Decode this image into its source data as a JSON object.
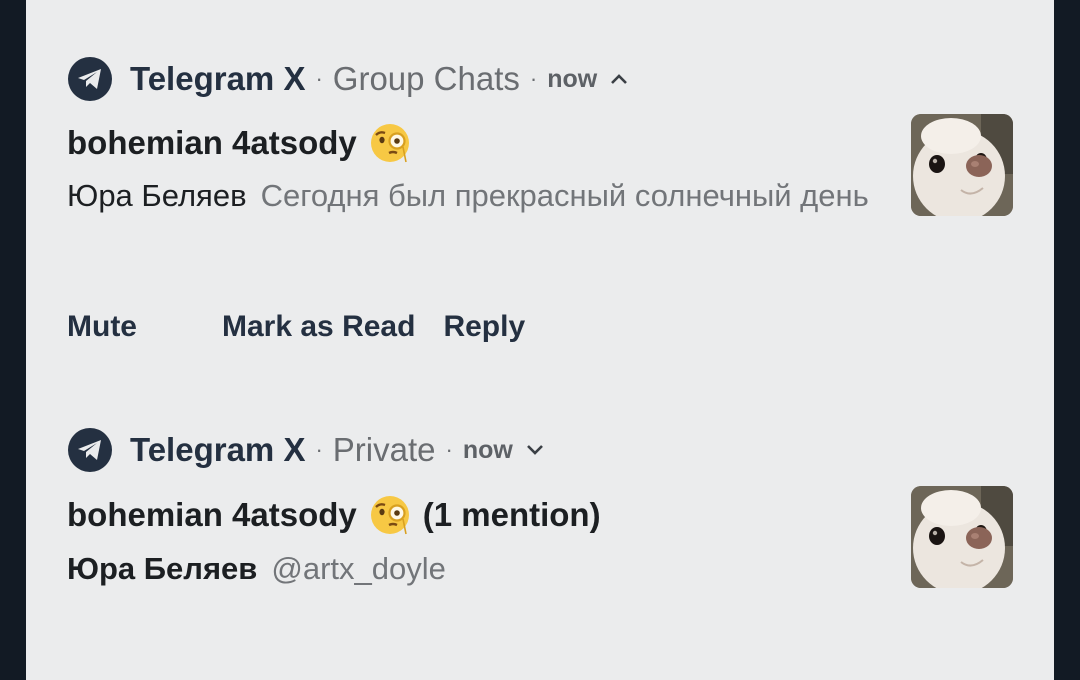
{
  "notifications": [
    {
      "app_name": "Telegram X",
      "separator": "·",
      "channel": "Group Chats",
      "time": "now",
      "expanded": true,
      "title": "bohemian 4atsody",
      "sender": "Юра Беляев",
      "message": "Сегодня был прекрасный солнечный день",
      "actions": {
        "mute": "Mute",
        "mark_read": "Mark as Read",
        "reply": "Reply"
      }
    },
    {
      "app_name": "Telegram X",
      "separator": "·",
      "channel": "Private",
      "time": "now",
      "expanded": false,
      "title": "bohemian 4atsody",
      "mention": "(1 mention)",
      "sender": "Юра Беляев",
      "message": "@artx_doyle"
    }
  ],
  "icons": [
    "telegram-icon",
    "chevron-up-icon",
    "chevron-down-icon",
    "face-with-monocle-emoji"
  ],
  "colors": {
    "panel": "#ebeced",
    "backdrop": "#121a24",
    "accent": "#243041",
    "secondary_text": "#727579"
  }
}
